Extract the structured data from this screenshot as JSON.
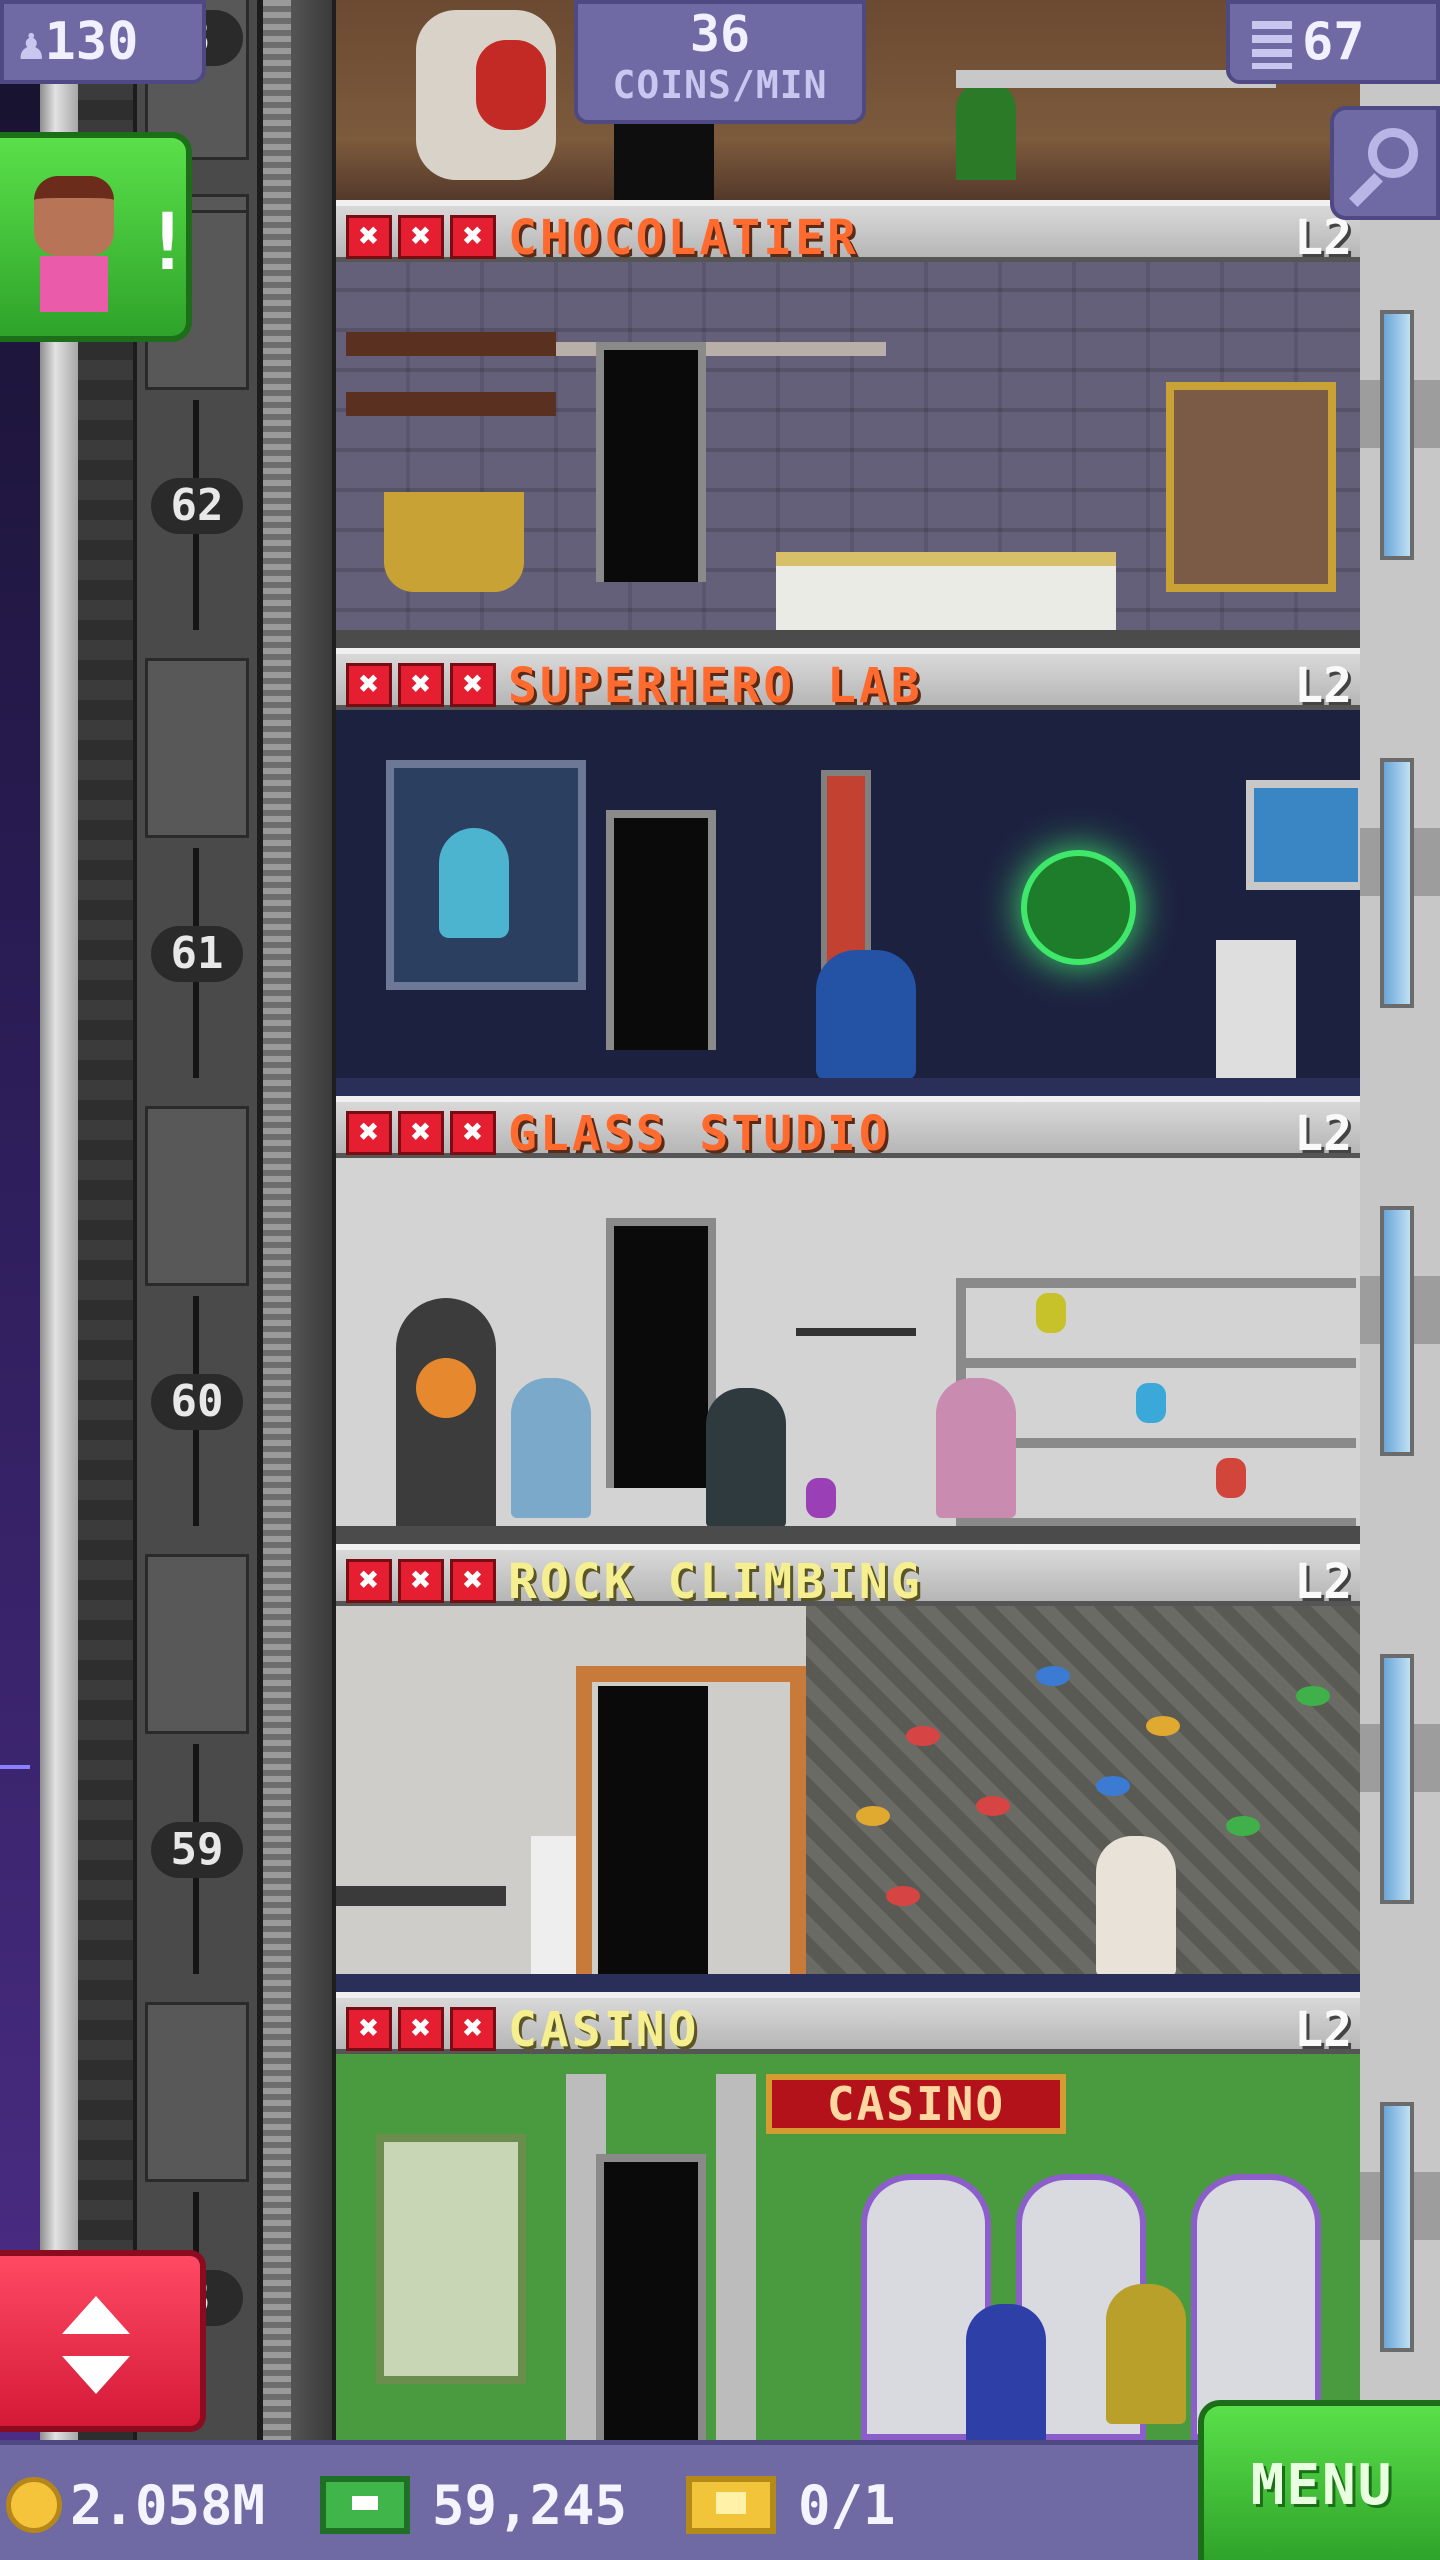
{
  "hud": {
    "population": "130",
    "coins_per_min_value": "36",
    "coins_per_min_label": "COINS/MIN",
    "floor_count": "67",
    "population_icon": "person-icon",
    "floors_icon": "building-icon",
    "search_icon": "magnifier-icon"
  },
  "elevator": {
    "floor_numbers": [
      "62",
      "61",
      "60",
      "59"
    ],
    "partial_top": "3",
    "partial_bottom": "8"
  },
  "floors": [
    {
      "name": "CHOCOLATIER",
      "level": "L2",
      "stars": [
        "✖",
        "✖",
        "✖"
      ],
      "name_color": "#ff6a2e"
    },
    {
      "name": "SUPERHERO LAB",
      "level": "L2",
      "stars": [
        "✖",
        "✖",
        "✖"
      ],
      "name_color": "#ff6a2e"
    },
    {
      "name": "GLASS STUDIO",
      "level": "L2",
      "stars": [
        "✖",
        "✖",
        "✖"
      ],
      "name_color": "#ff6a2e"
    },
    {
      "name": "ROCK CLIMBING",
      "level": "L2",
      "stars": [
        "✖",
        "✖",
        "✖"
      ],
      "name_color": "#f6ef8f"
    },
    {
      "name": "CASINO",
      "level": "L2",
      "stars": [
        "✖",
        "✖",
        "✖"
      ],
      "name_color": "#f6ef8f"
    }
  ],
  "casino_sign": "CASINO",
  "visitor": {
    "alert": "!",
    "icon": "visitor-alert-icon"
  },
  "bottom_bar": {
    "coins": "2.058M",
    "bux": "59,245",
    "tickets": "0/1",
    "menu_label": "MENU"
  },
  "colors": {
    "hud_purple": "#6f6aa4",
    "menu_green": "#2fa32a",
    "elevator_red": "#d41936",
    "star_red": "#e51f31"
  }
}
